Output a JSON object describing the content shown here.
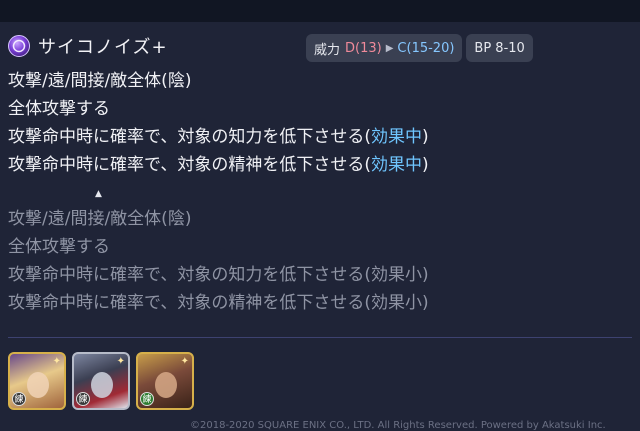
{
  "skill": {
    "name": "サイコノイズ+",
    "icon": "psychic-orb-icon"
  },
  "power": {
    "label": "威力",
    "from": "D(13)",
    "to": "C(15-20)"
  },
  "bp": "BP 8-10",
  "current": {
    "line1": "攻撃/遠/間接/敵全体(陰)",
    "line2": "全体攻撃する",
    "line3_pre": "攻撃命中時に確率で、対象の知力を低下させる(",
    "line3_hl": "効果中",
    "line3_post": ")",
    "line4_pre": "攻撃命中時に確率で、対象の精神を低下させる(",
    "line4_hl": "効果中",
    "line4_post": ")"
  },
  "previous": {
    "line1": "攻撃/遠/間接/敵全体(陰)",
    "line2": "全体攻撃する",
    "line3": "攻撃命中時に確率で、対象の知力を低下させる(効果小)",
    "line4": "攻撃命中時に確率で、対象の精神を低下させる(効果小)"
  },
  "characters": [
    {
      "grade": "練",
      "name": "character-portrait-1"
    },
    {
      "grade": "練",
      "name": "character-portrait-2"
    },
    {
      "grade": "練",
      "name": "character-portrait-3"
    }
  ],
  "copyright": "©2018-2020 SQUARE ENIX CO., LTD. All Rights Reserved. Powered by Akatsuki Inc.",
  "colors": {
    "highlight": "#6fc6ff",
    "power_from": "#f08a9a",
    "power_to": "#86c7ff"
  }
}
